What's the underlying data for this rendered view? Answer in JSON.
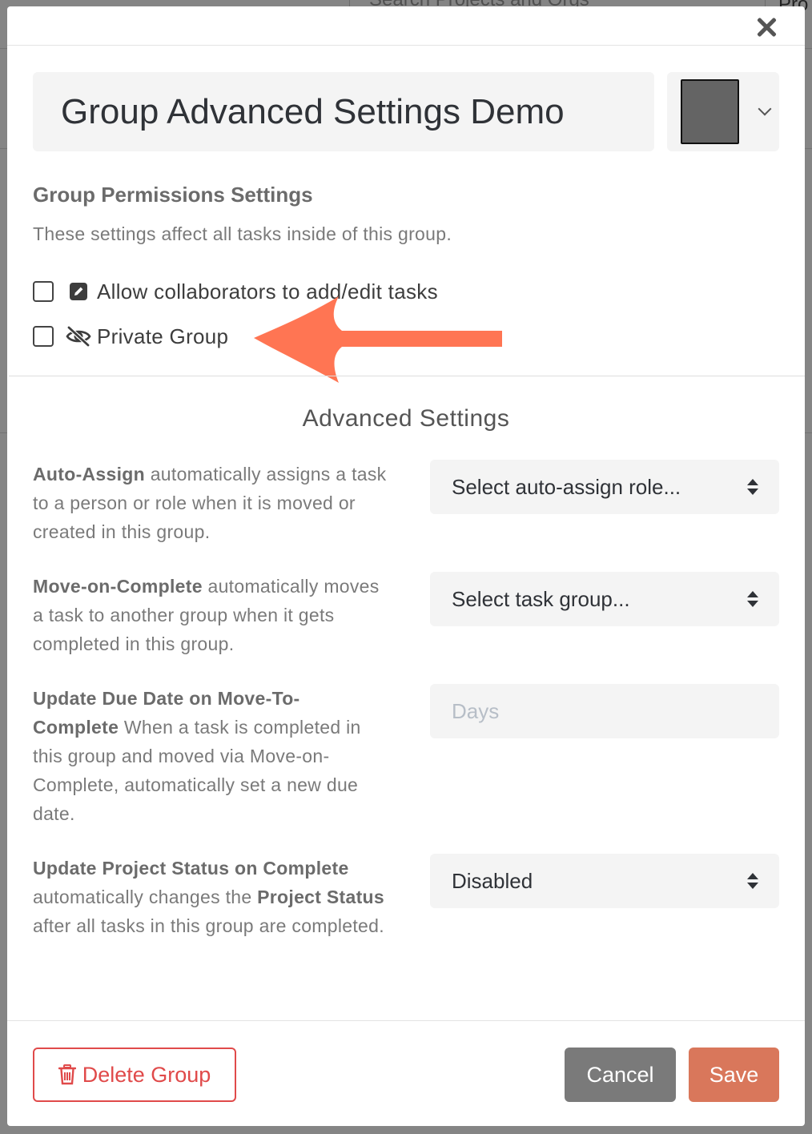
{
  "background": {
    "search_placeholder": "Search Projects and Orgs",
    "header_fragment": "Pro"
  },
  "modal": {
    "close_icon": "close-icon",
    "group_name": "Group Advanced Settings Demo",
    "group_color": "#646464",
    "permissions": {
      "title": "Group Permissions Settings",
      "description": "These settings affect all tasks inside of this group.",
      "allow_edit_label": "Allow collaborators to add/edit tasks",
      "allow_edit_checked": false,
      "private_label": "Private Group",
      "private_checked": false
    },
    "annotation_arrow_color": "#ff7553",
    "advanced": {
      "title": "Advanced Settings",
      "auto_assign": {
        "name": "Auto-Assign",
        "text": " automatically assigns a task to a person or role when it is moved or created in this group.",
        "select_value": "Select auto-assign role..."
      },
      "move_on_complete": {
        "name": "Move-on-Complete",
        "text": " automatically moves a task to another group when it gets completed in this group.",
        "select_value": "Select task group..."
      },
      "update_due_date": {
        "name": "Update Due Date on Move-To-Complete",
        "text": " When a task is completed in this group and moved via Move-on-Complete, automatically set a new due date.",
        "input_placeholder": "Days"
      },
      "update_status": {
        "name": "Update Project Status on Complete",
        "text_1": " automatically changes the ",
        "bold_2": "Project Status",
        "text_3": " after all tasks in this group are completed.",
        "select_value": "Disabled"
      }
    },
    "footer": {
      "delete_label": "Delete Group",
      "cancel_label": "Cancel",
      "save_label": "Save"
    }
  },
  "colors": {
    "danger": "#e04a4a",
    "save": "#d9775b",
    "cancel": "#7a7a7a"
  }
}
